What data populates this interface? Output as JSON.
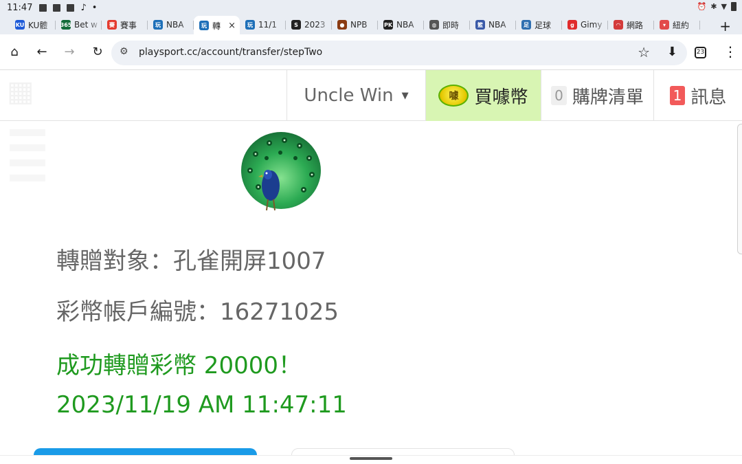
{
  "status_bar": {
    "time": "11:47",
    "tiktok_icon": "tiktok-icon",
    "dot": "•",
    "right_icons": [
      "alarm-icon",
      "bluetooth-icon",
      "wifi-icon",
      "battery-icon"
    ]
  },
  "tabs": [
    {
      "label": "KU體",
      "favicon_text": "KU",
      "favicon_color": "#1e5bd8"
    },
    {
      "label": "Bet w",
      "favicon_text": "365",
      "favicon_color": "#136c3a"
    },
    {
      "label": "賽事",
      "favicon_text": "賽",
      "favicon_color": "#e43b2f"
    },
    {
      "label": "NBA",
      "favicon_text": "玩",
      "favicon_color": "#1d6fb8"
    },
    {
      "label": "轉",
      "favicon_text": "玩",
      "favicon_color": "#1d6fb8",
      "active": true
    },
    {
      "label": "11/1",
      "favicon_text": "玩",
      "favicon_color": "#1d6fb8"
    },
    {
      "label": "2023",
      "favicon_text": "S",
      "favicon_color": "#222222"
    },
    {
      "label": "NPB",
      "favicon_text": "●",
      "favicon_color": "#8a3b12"
    },
    {
      "label": "NBA",
      "favicon_text": "PK",
      "favicon_color": "#222222"
    },
    {
      "label": "即時",
      "favicon_text": "◍",
      "favicon_color": "#555555"
    },
    {
      "label": "NBA",
      "favicon_text": "籃",
      "favicon_color": "#3a5aa8"
    },
    {
      "label": "足球",
      "favicon_text": "足",
      "favicon_color": "#2f6fb0"
    },
    {
      "label": "Gimy",
      "favicon_text": "g",
      "favicon_color": "#e02b2b"
    },
    {
      "label": "網路",
      "favicon_text": "◠",
      "favicon_color": "#d33b3b"
    },
    {
      "label": "紐約",
      "favicon_text": "▾",
      "favicon_color": "#e24a4a"
    }
  ],
  "tab_close": "×",
  "new_tab": "+",
  "toolbar": {
    "home": "⌂",
    "back": "←",
    "forward": "→",
    "reload": "↻",
    "url": "playsport.cc/account/transfer/stepTwo",
    "tab_count": "23"
  },
  "header": {
    "username": "Uncle Win",
    "buy_coin_label": "買噱幣",
    "coin_icon_text": "噱",
    "cart_count": "0",
    "cart_label": "購牌清單",
    "msg_count": "1",
    "msg_label": "訊息"
  },
  "result": {
    "recipient_line": "轉贈對象：孔雀開屏1007",
    "account_line": "彩幣帳戶編號：16271025",
    "success_line": "成功轉贈彩幣 20000！",
    "timestamp_line": "2023/11/19 AM 11:47:11"
  },
  "colors": {
    "success_green": "#1f9a1f",
    "buy_coin_bg": "#d8f5b3",
    "primary_blue": "#1a9be8",
    "badge_red": "#f25a5a"
  }
}
